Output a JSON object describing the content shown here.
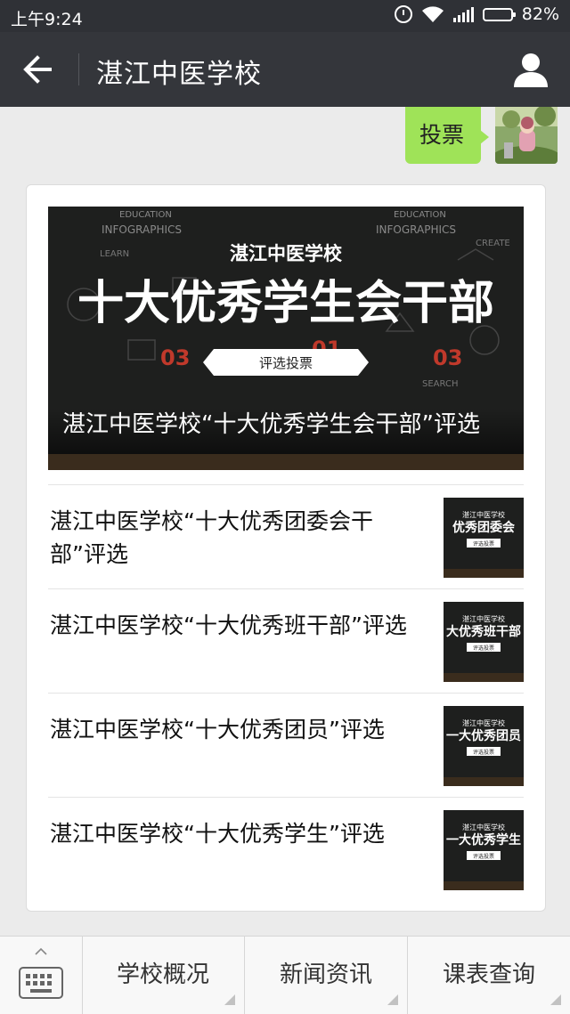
{
  "status_bar": {
    "time": "上午9:24",
    "battery": "82%",
    "battery_level": 0.82
  },
  "header": {
    "title": "湛江中医学校"
  },
  "chat": {
    "sent_message": "投票"
  },
  "article": {
    "cover": {
      "title": "湛江中医学校“十大优秀学生会干部”评选",
      "banner_school": "湛江中医学校",
      "banner_main": "十大优秀学生会干部",
      "banner_tag": "评选投票",
      "chalk_words": [
        "EDUCATION",
        "INFOGRAPHICS",
        "LEARN",
        "CREATE",
        "SEARCH",
        "01",
        "03"
      ]
    },
    "items": [
      {
        "title": "湛江中医学校“十大优秀团委会干部”评选",
        "thumb_school": "湛江中医学校",
        "thumb_main": "优秀团委会",
        "thumb_tag": "评选投票"
      },
      {
        "title": "湛江中医学校“十大优秀班干部”评选",
        "thumb_school": "湛江中医学校",
        "thumb_main": "大优秀班干部",
        "thumb_tag": "评选投票"
      },
      {
        "title": "湛江中医学校“十大优秀团员”评选",
        "thumb_school": "湛江中医学校",
        "thumb_main": "一大优秀团员",
        "thumb_tag": "评选投票"
      },
      {
        "title": "湛江中医学校“十大优秀学生”评选",
        "thumb_school": "湛江中医学校",
        "thumb_main": "一大优秀学生",
        "thumb_tag": "评选投票"
      }
    ]
  },
  "bottom_menu": [
    "学校概况",
    "新闻资讯",
    "课表查询"
  ],
  "colors": {
    "status_bar": "#2f3136",
    "title_bar": "#34363b",
    "bubble": "#9fe358",
    "background": "#ebebeb",
    "chalkboard": "#1e1f1e"
  }
}
